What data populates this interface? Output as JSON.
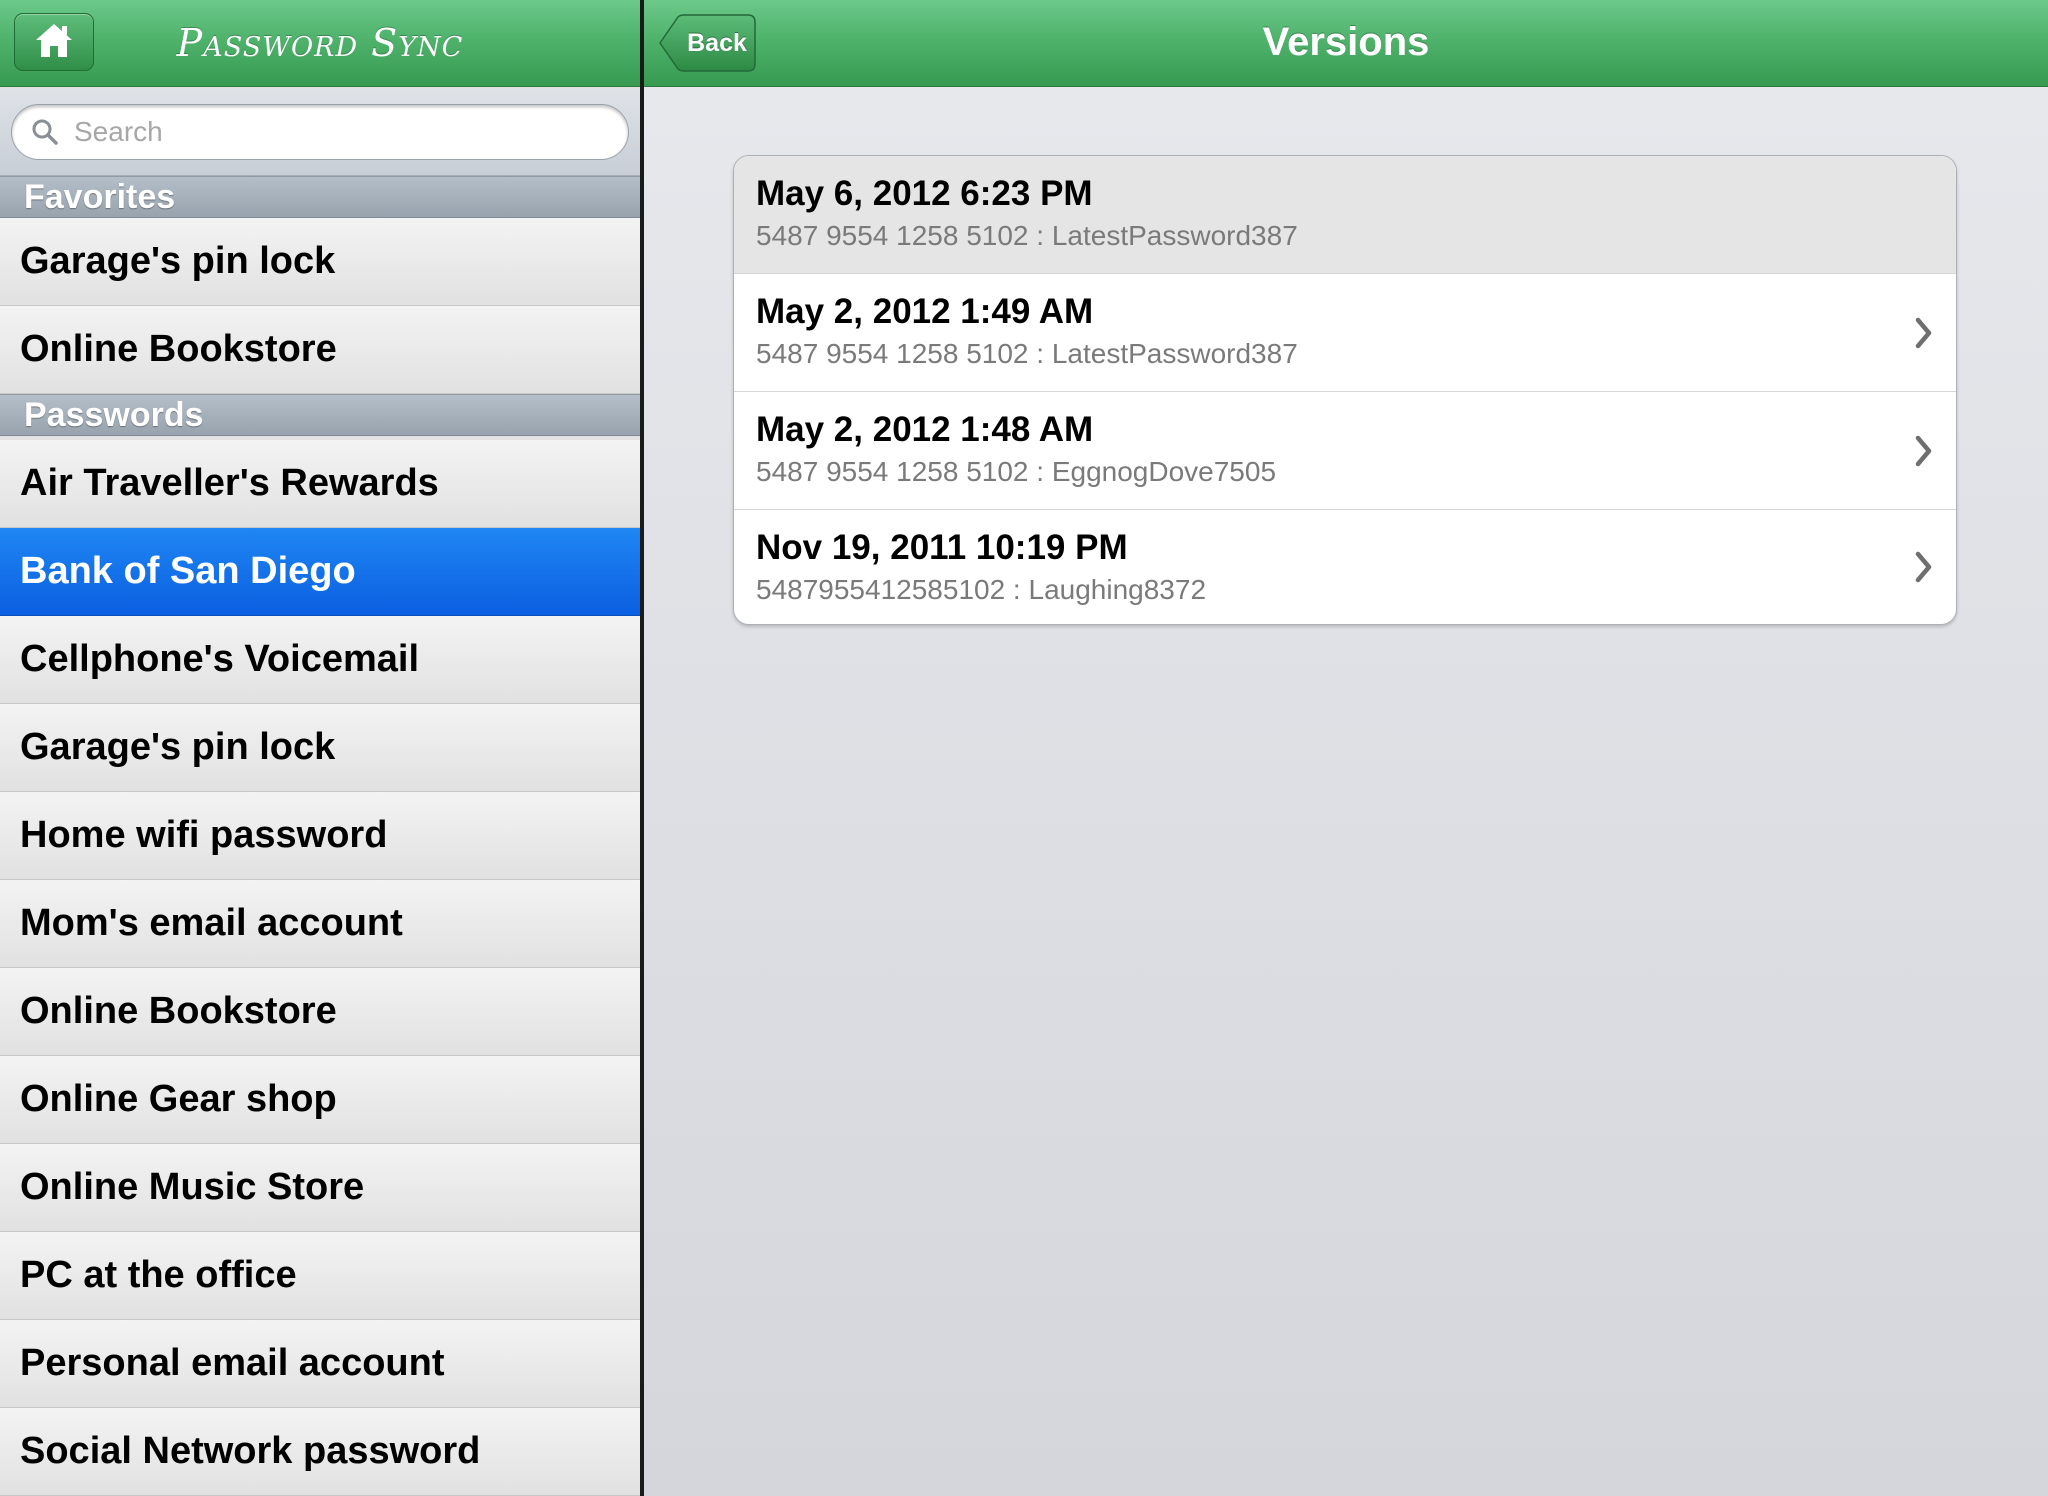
{
  "master": {
    "app_title": "Password Sync",
    "home_icon": "home-icon",
    "search": {
      "placeholder": "Search",
      "value": ""
    },
    "sections": [
      {
        "title": "Favorites",
        "items": [
          "Garage's pin lock",
          "Online Bookstore"
        ]
      },
      {
        "title": "Passwords",
        "items": [
          "Air Traveller's Rewards",
          "Bank of San Diego",
          "Cellphone's Voicemail",
          "Garage's pin lock",
          "Home wifi password",
          "Mom's email account",
          "Online Bookstore",
          "Online Gear shop",
          "Online Music Store",
          "PC at the office",
          "Personal email account",
          "Social Network password"
        ]
      }
    ],
    "selected_item": "Bank of San Diego"
  },
  "detail": {
    "back_label": "Back",
    "title": "Versions",
    "versions": [
      {
        "date": "May 6, 2012 6:23 PM",
        "detail": "5487 9554 1258 5102 : LatestPassword387",
        "current": true
      },
      {
        "date": "May 2, 2012 1:49 AM",
        "detail": "5487 9554 1258 5102 : LatestPassword387",
        "current": false
      },
      {
        "date": "May 2, 2012 1:48 AM",
        "detail": "5487 9554 1258 5102 : EggnogDove7505",
        "current": false
      },
      {
        "date": "Nov 19, 2011 10:19 PM",
        "detail": "5487955412585102 : Laughing8372",
        "current": false
      }
    ]
  },
  "colors": {
    "nav_green": "#4fb36c",
    "selection_blue": "#0b5fe1",
    "section_gray": "#98a3ae"
  }
}
